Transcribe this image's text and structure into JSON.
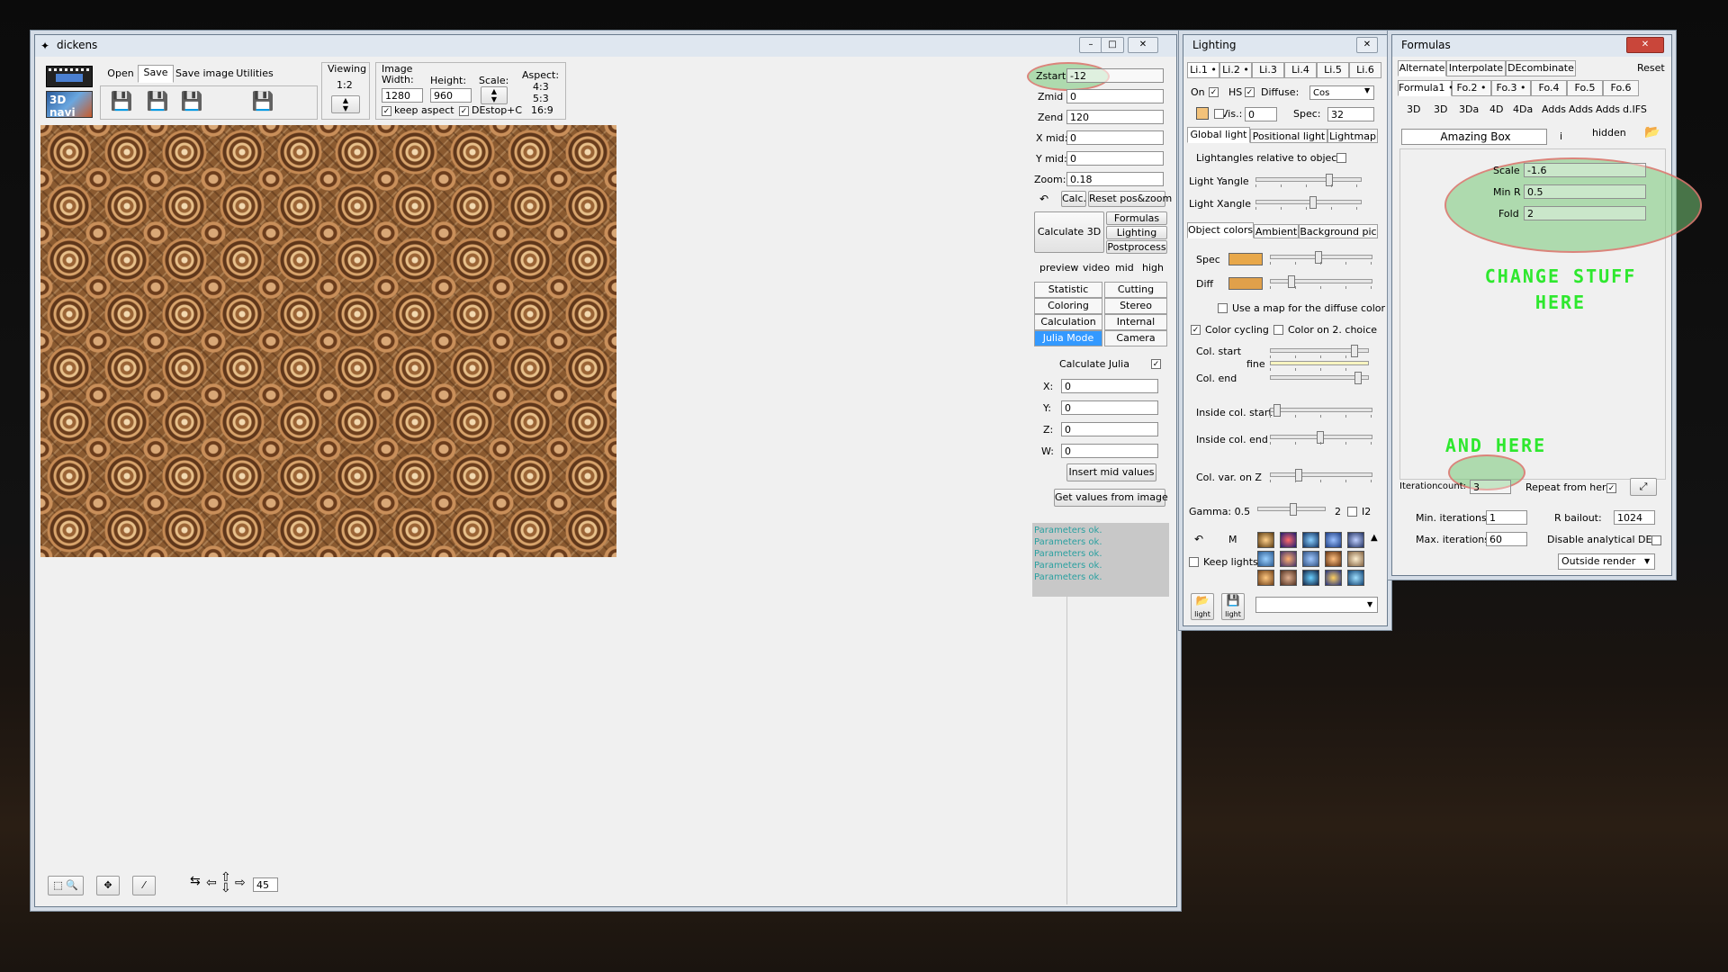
{
  "main_window": {
    "title": "dickens",
    "menu": {
      "open": "Open",
      "save": "Save",
      "save_image": "Save image",
      "utilities": "Utilities"
    },
    "nav3d_label": "3D navi",
    "save_icons": [
      "",
      "",
      "TXT",
      "JPEG+"
    ],
    "viewing": {
      "label": "Viewing",
      "value": "1:2"
    },
    "image": {
      "label": "Image",
      "width_label": "Width:",
      "height_label": "Height:",
      "width": "1280",
      "height": "960",
      "scale_label": "Scale:",
      "aspect_label": "Aspect:",
      "aspect_values": [
        "4:3",
        "5:3",
        "16:9"
      ],
      "keep_aspect": "keep aspect",
      "destop": "DEstop+C"
    },
    "params": [
      {
        "label": "Zstart",
        "value": "-12"
      },
      {
        "label": "Zmid",
        "value": "0"
      },
      {
        "label": "Zend",
        "value": "120"
      },
      {
        "label": "X mid:",
        "value": "0"
      },
      {
        "label": "Y mid:",
        "value": "0"
      },
      {
        "label": "Zoom:",
        "value": "0.18"
      }
    ],
    "calc_btn": "Calc.",
    "reset_btn": "Reset pos&zoom",
    "calculate_3d": "Calculate 3D",
    "side_buttons": [
      "Formulas",
      "Lighting",
      "Postprocess"
    ],
    "quality": [
      "preview",
      "video",
      "mid",
      "high"
    ],
    "tabs_left": [
      "Statistic",
      "Coloring",
      "Calculation",
      "Julia Mode"
    ],
    "tabs_right": [
      "Cutting",
      "Stereo",
      "Internal",
      "Camera"
    ],
    "julia": {
      "calc_label": "Calculate Julia",
      "x_label": "X:",
      "y_label": "Y:",
      "z_label": "Z:",
      "w_label": "W:",
      "x": "0",
      "y": "0",
      "z": "0",
      "w": "0",
      "insert_mid": "Insert mid values",
      "get_values": "Get values from image"
    },
    "log": [
      "Parameters ok.",
      "Parameters ok.",
      "Parameters ok.",
      "Parameters ok.",
      "Parameters ok."
    ],
    "bottom": {
      "step_value": "45"
    }
  },
  "lighting": {
    "title": "Lighting",
    "light_tabs": [
      "Li.1 •",
      "Li.2 •",
      "Li.3",
      "Li.4",
      "Li.5",
      "Li.6"
    ],
    "on_label": "On",
    "hs_label": "HS",
    "diffuse_label": "Diffuse:",
    "diffuse_value": "Cos",
    "vis_label": "Vis.:",
    "vis_value": "0",
    "spec_label": "Spec:",
    "spec_value": "32",
    "light_type_tabs": [
      "Global light",
      "Positional light",
      "Lightmap"
    ],
    "lightangles": "Lightangles relative to object",
    "yangle": "Light Yangle",
    "xangle": "Light Xangle",
    "color_tabs": [
      "Object colors",
      "Ambient",
      "Background pic"
    ],
    "spec": "Spec",
    "diff": "Diff",
    "use_map": "Use a map for the diffuse color",
    "color_cycling": "Color cycling",
    "color_on_2": "Color on 2. choice",
    "col_start": "Col. start",
    "fine": "fine",
    "col_end": "Col. end",
    "inside_start": "Inside col. start",
    "inside_end": "Inside col. end",
    "col_var": "Col. var. on Z",
    "gamma": "Gamma: 0.5",
    "gamma_2": "2",
    "gamma_i2": "I2",
    "m_label": "M",
    "keep_lights": "Keep lights",
    "light_label": "light"
  },
  "formulas": {
    "title": "Formulas",
    "top_tabs": [
      "Alternate",
      "Interpolate",
      "DEcombinate"
    ],
    "reset": "Reset",
    "formula_tabs": [
      "Formula1 •",
      "Fo.2 •",
      "Fo.3 •",
      "Fo.4",
      "Fo.5",
      "Fo.6"
    ],
    "type_tabs": [
      "3D",
      "3D",
      "3Da",
      "4D",
      "4Da",
      "Adds",
      "Adds",
      "Adds",
      "d.IFS"
    ],
    "formula_name": "Amazing Box",
    "info": "i",
    "hidden": "hidden",
    "params": [
      {
        "label": "Scale",
        "value": "-1.6"
      },
      {
        "label": "Min R",
        "value": "0.5"
      },
      {
        "label": "Fold",
        "value": "2"
      }
    ],
    "annotation_1": "CHANGE STUFF HERE",
    "annotation_2": "AND HERE",
    "iter_label": "Iterationcount:",
    "iter_value": "3",
    "repeat_label": "Repeat from here",
    "min_iter_label": "Min. iterations:",
    "min_iter": "1",
    "max_iter_label": "Max. iterations:",
    "max_iter": "60",
    "bailout_label": "R bailout:",
    "bailout": "1024",
    "disable_de": "Disable analytical DE",
    "render_mode": "Outside render"
  },
  "colors": {
    "accent_selected": "#3399ff",
    "annotation_green": "#2ee82e",
    "log_text": "#2aa0a0"
  }
}
